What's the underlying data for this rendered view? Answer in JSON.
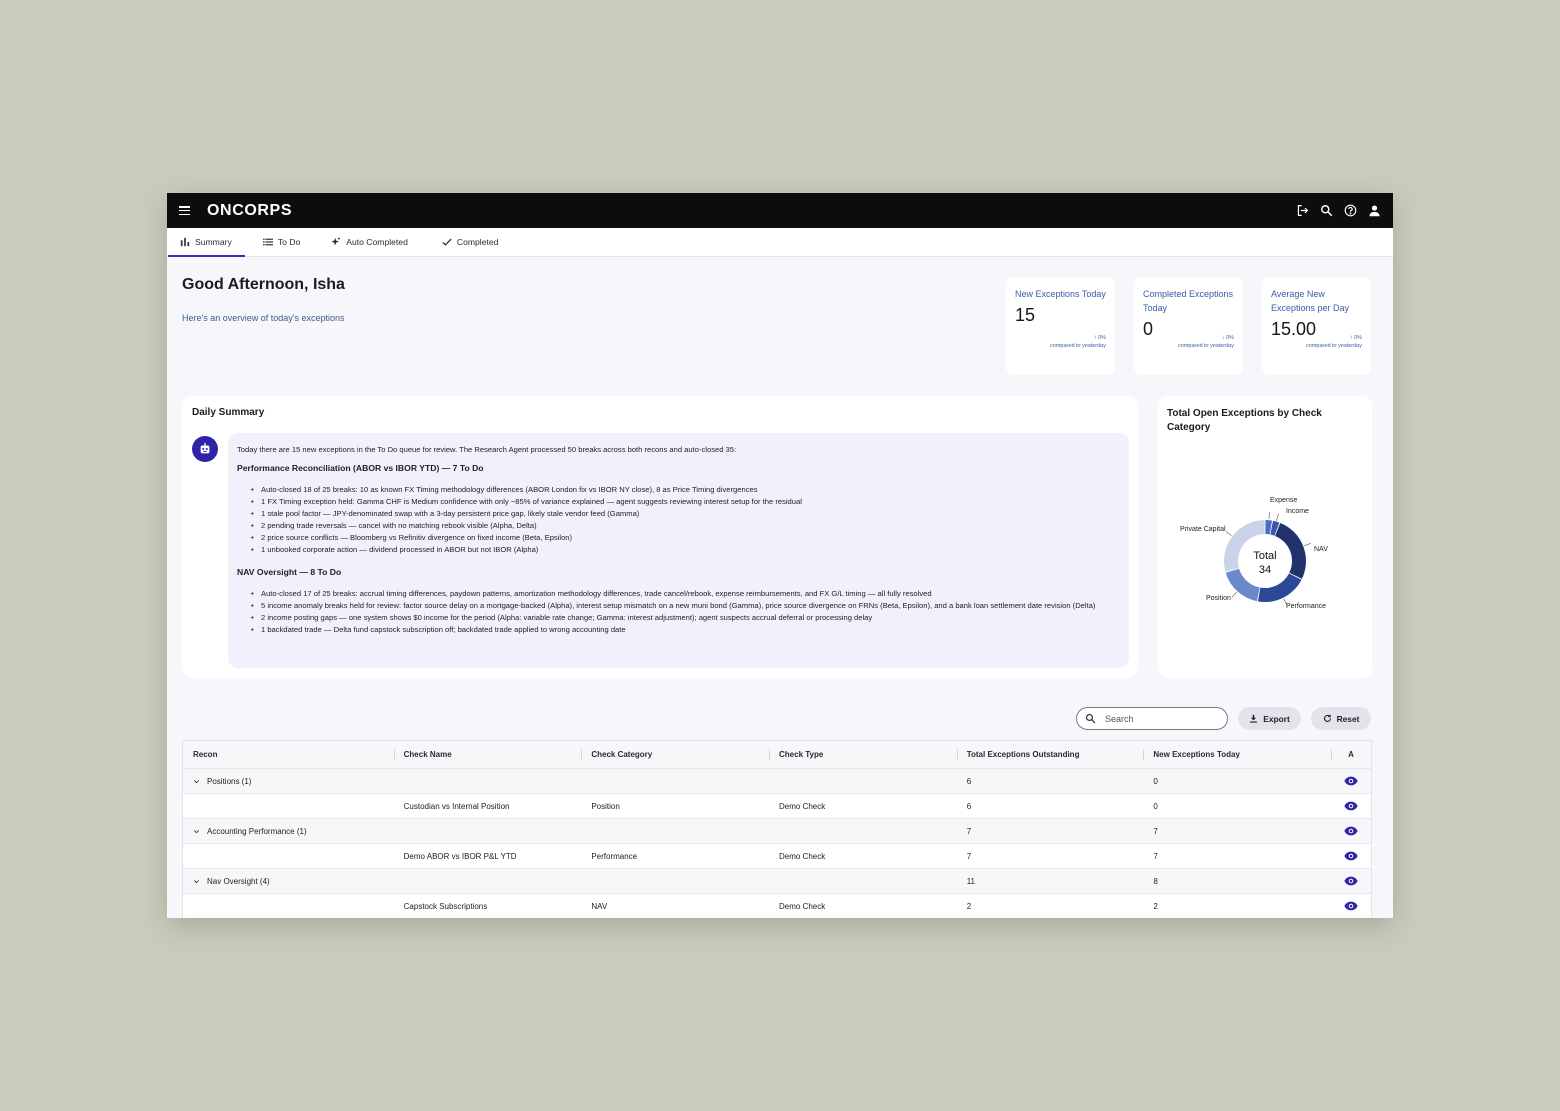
{
  "app": {
    "logo": "ONCORPS"
  },
  "topbar": {
    "icons": [
      "logout-icon",
      "search-icon",
      "help-icon",
      "account-icon"
    ]
  },
  "tabs": [
    {
      "label": "Summary",
      "icon": "bar-chart-icon",
      "active": true
    },
    {
      "label": "To Do",
      "icon": "list-icon"
    },
    {
      "label": "Auto Completed",
      "icon": "sparkle-icon"
    },
    {
      "label": "Completed",
      "icon": "check-icon"
    }
  ],
  "header": {
    "greeting": "Good Afternoon, Isha",
    "subtitle": "Here's an overview of today's exceptions"
  },
  "stats": [
    {
      "label": "New Exceptions Today",
      "value": "15",
      "delta_arrow": "↑",
      "delta": "0%",
      "compare": "compared to yesterday"
    },
    {
      "label": "Completed Exceptions Today",
      "value": "0",
      "delta_arrow": "↓",
      "delta": "0%",
      "compare": "compared to yesterday"
    },
    {
      "label": "Average New Exceptions per Day",
      "value": "15.00",
      "delta_arrow": "↑",
      "delta": "0%",
      "compare": "compared to yesterday"
    }
  ],
  "daily_summary": {
    "title": "Daily Summary",
    "intro": "Today there are 15 new exceptions in the To Do queue for review. The Research Agent processed 50 breaks across both recons and auto-closed 35:",
    "sections": [
      {
        "heading": "Performance Reconciliation (ABOR vs IBOR YTD) — 7 To Do",
        "bullets": [
          "Auto-closed 18 of 25 breaks: 10 as known FX Timing methodology differences (ABOR London fix vs IBOR NY close), 8 as Price Timing divergences",
          "1 FX Timing exception held: Gamma CHF is Medium confidence with only ~85% of variance explained — agent suggests reviewing interest setup for the residual",
          "1 stale pool factor — JPY-denominated swap with a 3-day persistent price gap, likely stale vendor feed (Gamma)",
          "2 pending trade reversals — cancel with no matching rebook visible (Alpha, Delta)",
          "2 price source conflicts — Bloomberg vs Refinitiv divergence on fixed income (Beta, Epsilon)",
          "1 unbooked corporate action — dividend processed in ABOR but not IBOR (Alpha)"
        ]
      },
      {
        "heading": "NAV Oversight — 8 To Do",
        "bullets": [
          "Auto-closed 17 of 25 breaks: accrual timing differences, paydown patterns, amortization methodology differences, trade cancel/rebook, expense reimbursements, and FX G/L timing — all fully resolved",
          "5 income anomaly breaks held for review: factor source delay on a mortgage-backed (Alpha), interest setup mismatch on a new muni bond (Gamma), price source divergence on FRNs (Beta, Epsilon), and a bank loan settlement date revision (Delta)",
          "2 income posting gaps — one system shows $0 income for the period (Alpha: variable rate change; Gamma: interest adjustment); agent suspects accrual deferral or processing delay",
          "1 backdated trade — Delta fund capstock subscription off; backdated trade applied to wrong accounting date"
        ]
      }
    ]
  },
  "chart_data": {
    "type": "pie",
    "title": "Total Open Exceptions by Check Category",
    "center_label": "Total",
    "total": 34,
    "slices": [
      {
        "label": "Expense",
        "value": 1,
        "color": "#4a6fc4"
      },
      {
        "label": "Income",
        "value": 1,
        "color": "#3d57a8"
      },
      {
        "label": "NAV",
        "value": 9,
        "color": "#22336b"
      },
      {
        "label": "Performance",
        "value": 7,
        "color": "#2b4996"
      },
      {
        "label": "Position",
        "value": 6,
        "color": "#6a8acb"
      },
      {
        "label": "Private Capital",
        "value": 10,
        "color": "#c9d3ea"
      }
    ]
  },
  "toolbar": {
    "search_placeholder": "Search",
    "export_label": "Export",
    "reset_label": "Reset"
  },
  "table": {
    "columns": [
      "Recon",
      "Check Name",
      "Check Category",
      "Check Type",
      "Total Exceptions Outstanding",
      "New Exceptions Today",
      "A"
    ],
    "rows": [
      {
        "kind": "group",
        "recon": "Positions (1)",
        "check_name": "",
        "category": "",
        "type": "",
        "total": "6",
        "new": "0"
      },
      {
        "kind": "item",
        "recon": "",
        "check_name": "Custodian vs Internal Position",
        "category": "Position",
        "type": "Demo Check",
        "total": "6",
        "new": "0"
      },
      {
        "kind": "group",
        "recon": "Accounting Performance (1)",
        "check_name": "",
        "category": "",
        "type": "",
        "total": "7",
        "new": "7"
      },
      {
        "kind": "item",
        "recon": "",
        "check_name": "Demo ABOR vs IBOR P&L YTD",
        "category": "Performance",
        "type": "Demo Check",
        "total": "7",
        "new": "7"
      },
      {
        "kind": "group",
        "recon": "Nav Oversight (4)",
        "check_name": "",
        "category": "",
        "type": "",
        "total": "11",
        "new": "8"
      },
      {
        "kind": "item",
        "recon": "",
        "check_name": "Capstock Subscriptions",
        "category": "NAV",
        "type": "Demo Check",
        "total": "2",
        "new": "2"
      }
    ]
  }
}
